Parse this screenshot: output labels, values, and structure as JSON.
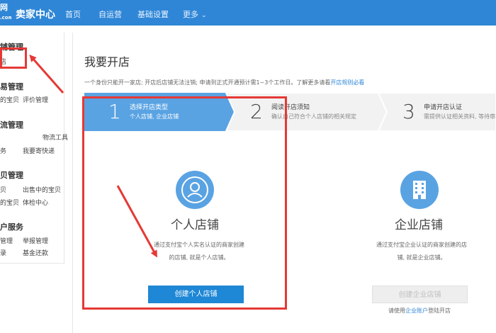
{
  "header": {
    "logo_text": "网",
    "logo_sub": ".com",
    "app_title": "卖家中心",
    "nav": [
      {
        "label": "首页"
      },
      {
        "label": "自运营"
      },
      {
        "label": "基础设置"
      },
      {
        "label": "更多"
      }
    ]
  },
  "sidebar": {
    "sections": [
      {
        "title": "铺管理",
        "links": [
          "店"
        ]
      },
      {
        "title": "易管理",
        "links": [
          "的宝贝",
          "评价管理"
        ]
      },
      {
        "title": "流管理",
        "links": [
          "物流工具",
          "务",
          "我要寄快递"
        ]
      },
      {
        "title": "贝管理",
        "links": [
          "贝",
          "出售中的宝贝",
          "的宝贝",
          "体检中心"
        ]
      },
      {
        "title": "户服务",
        "links": [
          "管理",
          "举报管理",
          "录",
          "基金还款"
        ]
      }
    ]
  },
  "main": {
    "page_title": "我要开店",
    "notice_text": "一个身份只能开一家店; 开店后店铺无法注销; 申请到正式开通预计需1~3个工作日。了解更多请看",
    "notice_link": "开店规则必看",
    "steps": [
      {
        "num": "1",
        "title": "选择开店类型",
        "desc": "个人店铺, 企业店铺"
      },
      {
        "num": "2",
        "title": "阅读开店须知",
        "desc": "确认自己符合个人店铺的相关规定"
      },
      {
        "num": "3",
        "title": "申请开店认证",
        "desc": "需提供认证相关资料, 等待审核"
      }
    ],
    "personal": {
      "title": "个人店铺",
      "desc1": "通过支付宝个人实名认证的商家创建",
      "desc2": "的店铺, 就是个人店铺。",
      "button": "创建个人店铺"
    },
    "enterprise": {
      "title": "企业店铺",
      "desc1": "通过支付宝企业认证的商家创建的店",
      "desc2": "铺, 就是企业店铺。",
      "button": "创建企业店铺",
      "note_prefix": "请使用",
      "note_link": "企业账户",
      "note_suffix": "登陆开店"
    }
  },
  "colors": {
    "topbar": "#2f86d6",
    "step_active": "#5aa3e3",
    "step_inactive": "#f2f2f2",
    "primary_button": "#1e87d6",
    "annotation_red": "#e53935"
  }
}
